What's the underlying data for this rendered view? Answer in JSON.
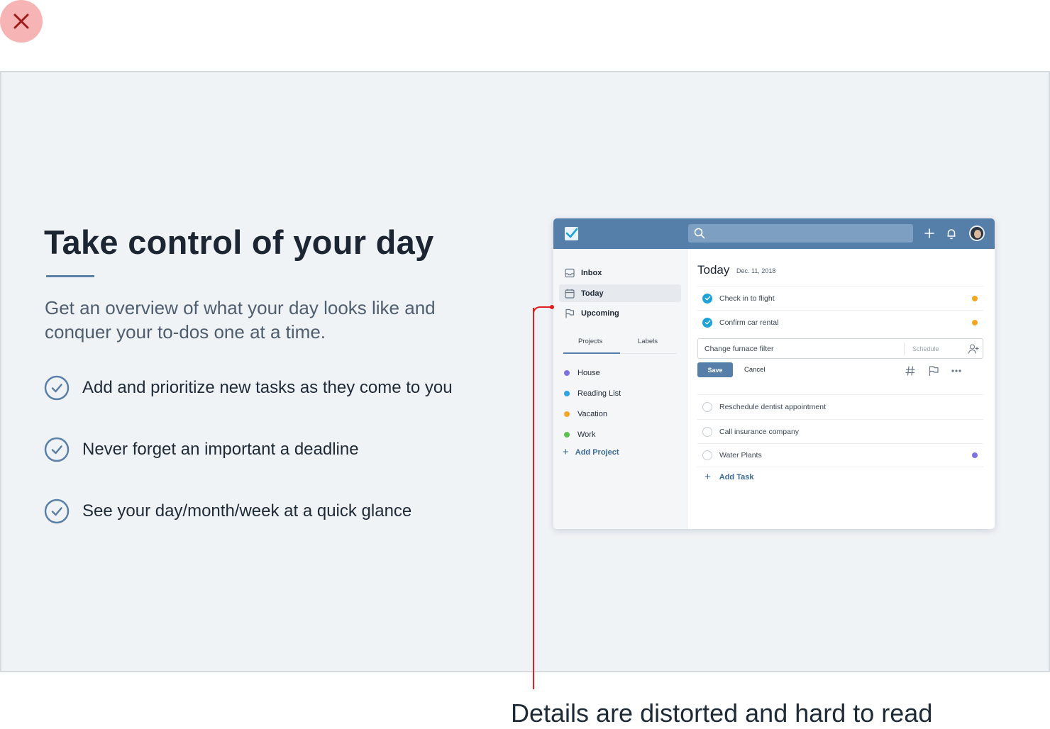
{
  "close_button": {
    "icon": "close-icon",
    "color": "#f7b4b4"
  },
  "hero": {
    "title": "Take control of your day",
    "subtitle": "Get an overview of what your day looks like and conquer your to-dos one at a time.",
    "features": [
      "Add and prioritize new tasks as they come to you",
      "Never forget an important a deadline",
      "See your day/month/week at a quick glance"
    ]
  },
  "app": {
    "header_color": "#557fa8",
    "search": {
      "placeholder": ""
    },
    "sidebar": {
      "nav": [
        {
          "label": "Inbox",
          "icon": "inbox-icon"
        },
        {
          "label": "Today",
          "icon": "calendar-icon",
          "active": true
        },
        {
          "label": "Upcoming",
          "icon": "flag-icon"
        }
      ],
      "tabs": [
        "Projects",
        "Labels"
      ],
      "projects": [
        {
          "label": "House",
          "color": "#7b74e0"
        },
        {
          "label": "Reading List",
          "color": "#2da4e6"
        },
        {
          "label": "Vacation",
          "color": "#f5a623"
        },
        {
          "label": "Work",
          "color": "#5cc152"
        }
      ],
      "add_project": "Add Project"
    },
    "main": {
      "title": "Today",
      "date": "Dec. 11, 2018",
      "done_tasks": [
        {
          "label": "Check in to flight",
          "flag_color": "#f5a623"
        },
        {
          "label": "Confirm car rental",
          "flag_color": "#f5a623"
        }
      ],
      "editing": {
        "value": "Change furnace filter",
        "schedule_placeholder": "Schedule",
        "save": "Save",
        "cancel": "Cancel"
      },
      "open_tasks": [
        {
          "label": "Reschedule dentist appointment",
          "flag_color": ""
        },
        {
          "label": "Call insurance company",
          "flag_color": ""
        },
        {
          "label": "Water Plants",
          "flag_color": "#7b74e0"
        }
      ],
      "add_task": "Add Task"
    }
  },
  "annotation": {
    "text": "Details are distorted and hard to read",
    "color": "#e02020"
  }
}
